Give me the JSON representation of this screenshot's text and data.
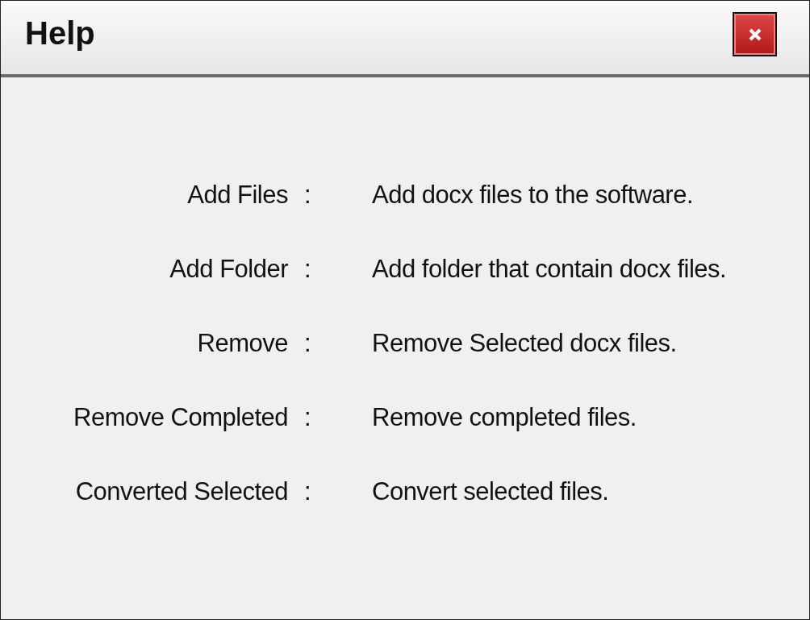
{
  "window": {
    "title": "Help"
  },
  "items": [
    {
      "label": "Add Files",
      "separator": ":",
      "description": "Add docx files to the software."
    },
    {
      "label": "Add Folder",
      "separator": ":",
      "description": "Add folder that contain docx files."
    },
    {
      "label": "Remove",
      "separator": ":",
      "description": "Remove Selected docx files."
    },
    {
      "label": "Remove Completed",
      "separator": ":",
      "description": "Remove completed files."
    },
    {
      "label": "Converted Selected",
      "separator": ":",
      "description": "Convert selected files."
    }
  ]
}
